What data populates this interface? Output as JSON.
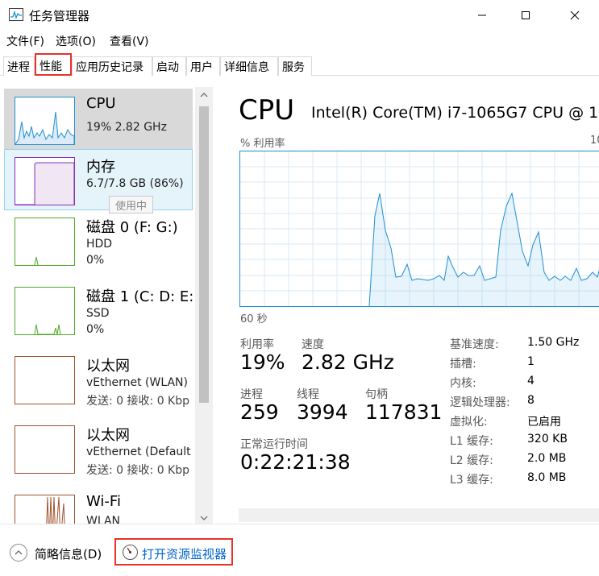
{
  "window": {
    "title": "任务管理器"
  },
  "menu": [
    "文件(F)",
    "选项(O)",
    "查看(V)"
  ],
  "tabs": [
    "进程",
    "性能",
    "应用历史记录",
    "启动",
    "用户",
    "详细信息",
    "服务"
  ],
  "active_tab": "性能",
  "resources": [
    {
      "name": "CPU",
      "line1": "19%  2.82 GHz",
      "line2": "",
      "color": "#1e90d4"
    },
    {
      "name": "内存",
      "line1": "6.7/7.8 GB (86%)",
      "line2": "",
      "color": "#8b2fb6"
    },
    {
      "name": "磁盘 0 (F: G:)",
      "line1": "HDD",
      "line2": "0%",
      "color": "#4daa22"
    },
    {
      "name": "磁盘 1 (C: D: E:",
      "line1": "SSD",
      "line2": "0%",
      "color": "#4daa22"
    },
    {
      "name": "以太网",
      "line1": "vEthernet (WLAN)",
      "line2": "发送: 0  接收: 0 Kbp",
      "color": "#a0522d"
    },
    {
      "name": "以太网",
      "line1": "vEthernet (Default",
      "line2": "发送: 0  接收: 0 Kbp",
      "color": "#a0522d"
    },
    {
      "name": "Wi-Fi",
      "line1": "WLAN",
      "line2": "",
      "color": "#a0522d"
    }
  ],
  "tooltip": "使用中",
  "detail": {
    "title": "CPU",
    "model": "Intel(R) Core(TM) i7-1065G7 CPU @ 1",
    "util_label": "% 利用率",
    "util_max": "10",
    "time_label": "60 秒",
    "stats": {
      "util_label": "利用率",
      "util_value": "19%",
      "speed_label": "速度",
      "speed_value": "2.82 GHz",
      "proc_label": "进程",
      "proc_value": "259",
      "thread_label": "线程",
      "thread_value": "3994",
      "handle_label": "句柄",
      "handle_value": "117831",
      "uptime_label": "正常运行时间",
      "uptime_value": "0:22:21:38"
    },
    "specs": [
      {
        "label": "基准速度:",
        "value": "1.50 GHz"
      },
      {
        "label": "插槽:",
        "value": "1"
      },
      {
        "label": "内核:",
        "value": "4"
      },
      {
        "label": "逻辑处理器:",
        "value": "8"
      },
      {
        "label": "虚拟化:",
        "value": "已启用"
      },
      {
        "label": "L1 缓存:",
        "value": "320 KB"
      },
      {
        "label": "L2 缓存:",
        "value": "2.0 MB"
      },
      {
        "label": "L3 缓存:",
        "value": "8.0 MB"
      }
    ],
    "graph_color": "#1e90d4"
  },
  "footer": {
    "brief": "简略信息(D)",
    "resmon": "打开资源监视器"
  }
}
